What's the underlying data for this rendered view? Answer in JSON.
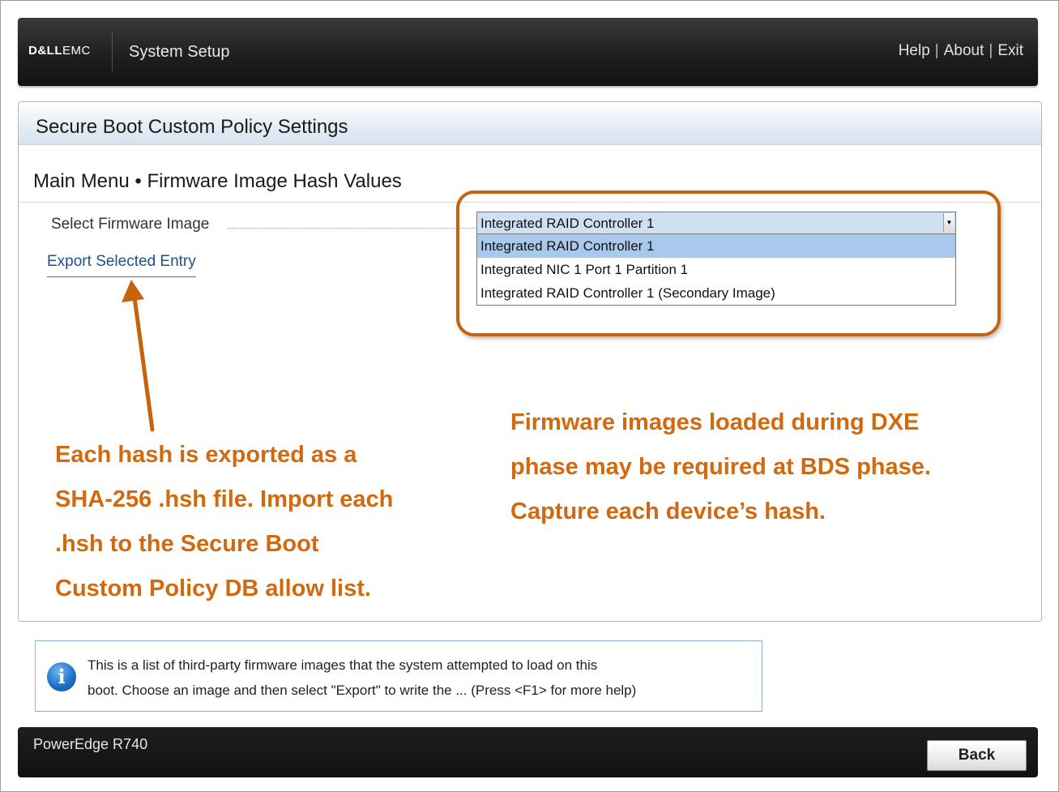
{
  "header": {
    "logo": {
      "dell": "D&LL",
      "emc": "EMC"
    },
    "app_title": "System Setup",
    "links": {
      "help": "Help",
      "about": "About",
      "exit": "Exit",
      "separator": "|"
    }
  },
  "panel": {
    "title": "Secure Boot Custom Policy Settings",
    "breadcrumb": "Main Menu • Firmware Image Hash Values",
    "select_firmware": {
      "label": "Select Firmware Image",
      "value": "Integrated RAID Controller 1",
      "options": [
        "Integrated RAID Controller 1",
        "Integrated NIC 1 Port 1 Partition 1",
        "Integrated RAID Controller 1 (Secondary Image)"
      ],
      "selected_index": 0
    },
    "export_link": "Export Selected Entry"
  },
  "annotations": {
    "left": [
      "Each hash is exported as a",
      "SHA-256 .hsh file. Import each",
      ".hsh to the Secure Boot",
      "Custom Policy DB allow list."
    ],
    "right": [
      "Firmware images loaded during DXE",
      "phase may be required at BDS phase.",
      "Capture each device’s hash."
    ],
    "color": "#d2690f"
  },
  "help": {
    "icon": "info-icon",
    "line1": "This is a list of third-party firmware images that the system attempted to load on this",
    "line2": "boot. Choose an image and then select \"Export\" to write the ... (Press <F1> for more help)"
  },
  "footer": {
    "model": "PowerEdge R740",
    "back_label": "Back"
  }
}
